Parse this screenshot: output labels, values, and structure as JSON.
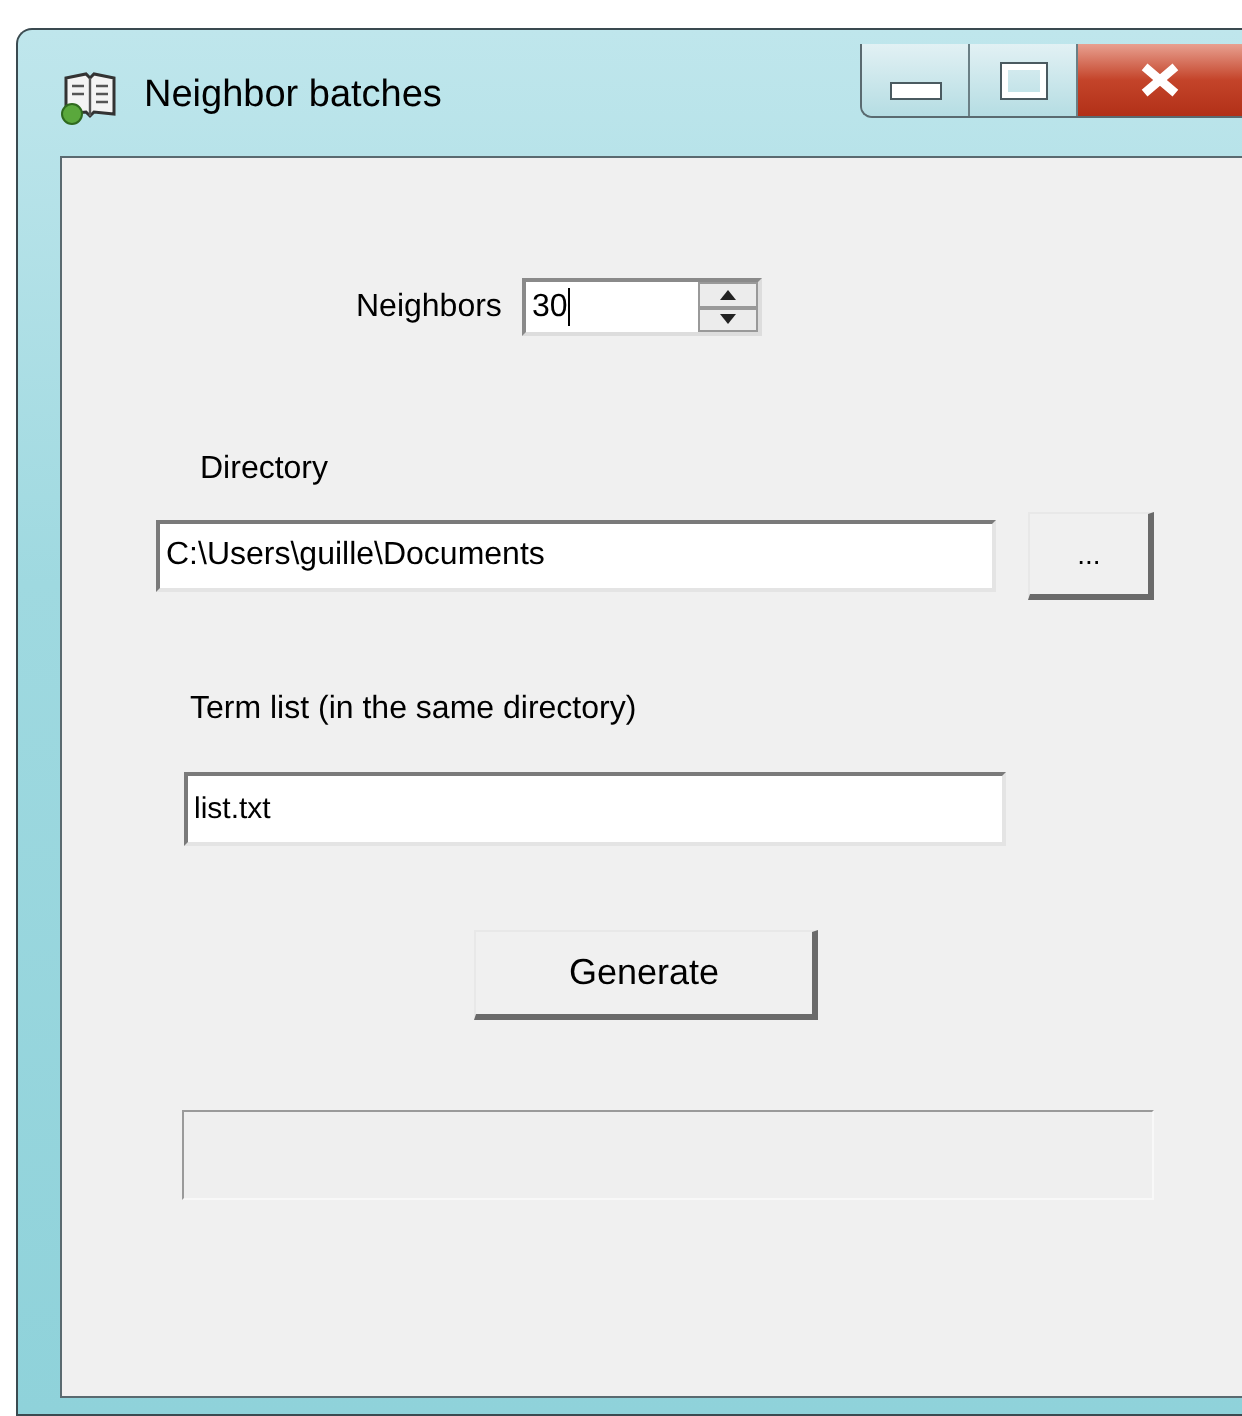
{
  "window": {
    "title": "Neighbor batches"
  },
  "neighbors": {
    "label": "Neighbors",
    "value": "30"
  },
  "directory": {
    "label": "Directory",
    "value": "C:\\Users\\guille\\Documents",
    "browse_button": "..."
  },
  "term_list": {
    "label": "Term list (in the same directory)",
    "value": "list.txt"
  },
  "generate_button": "Generate"
}
